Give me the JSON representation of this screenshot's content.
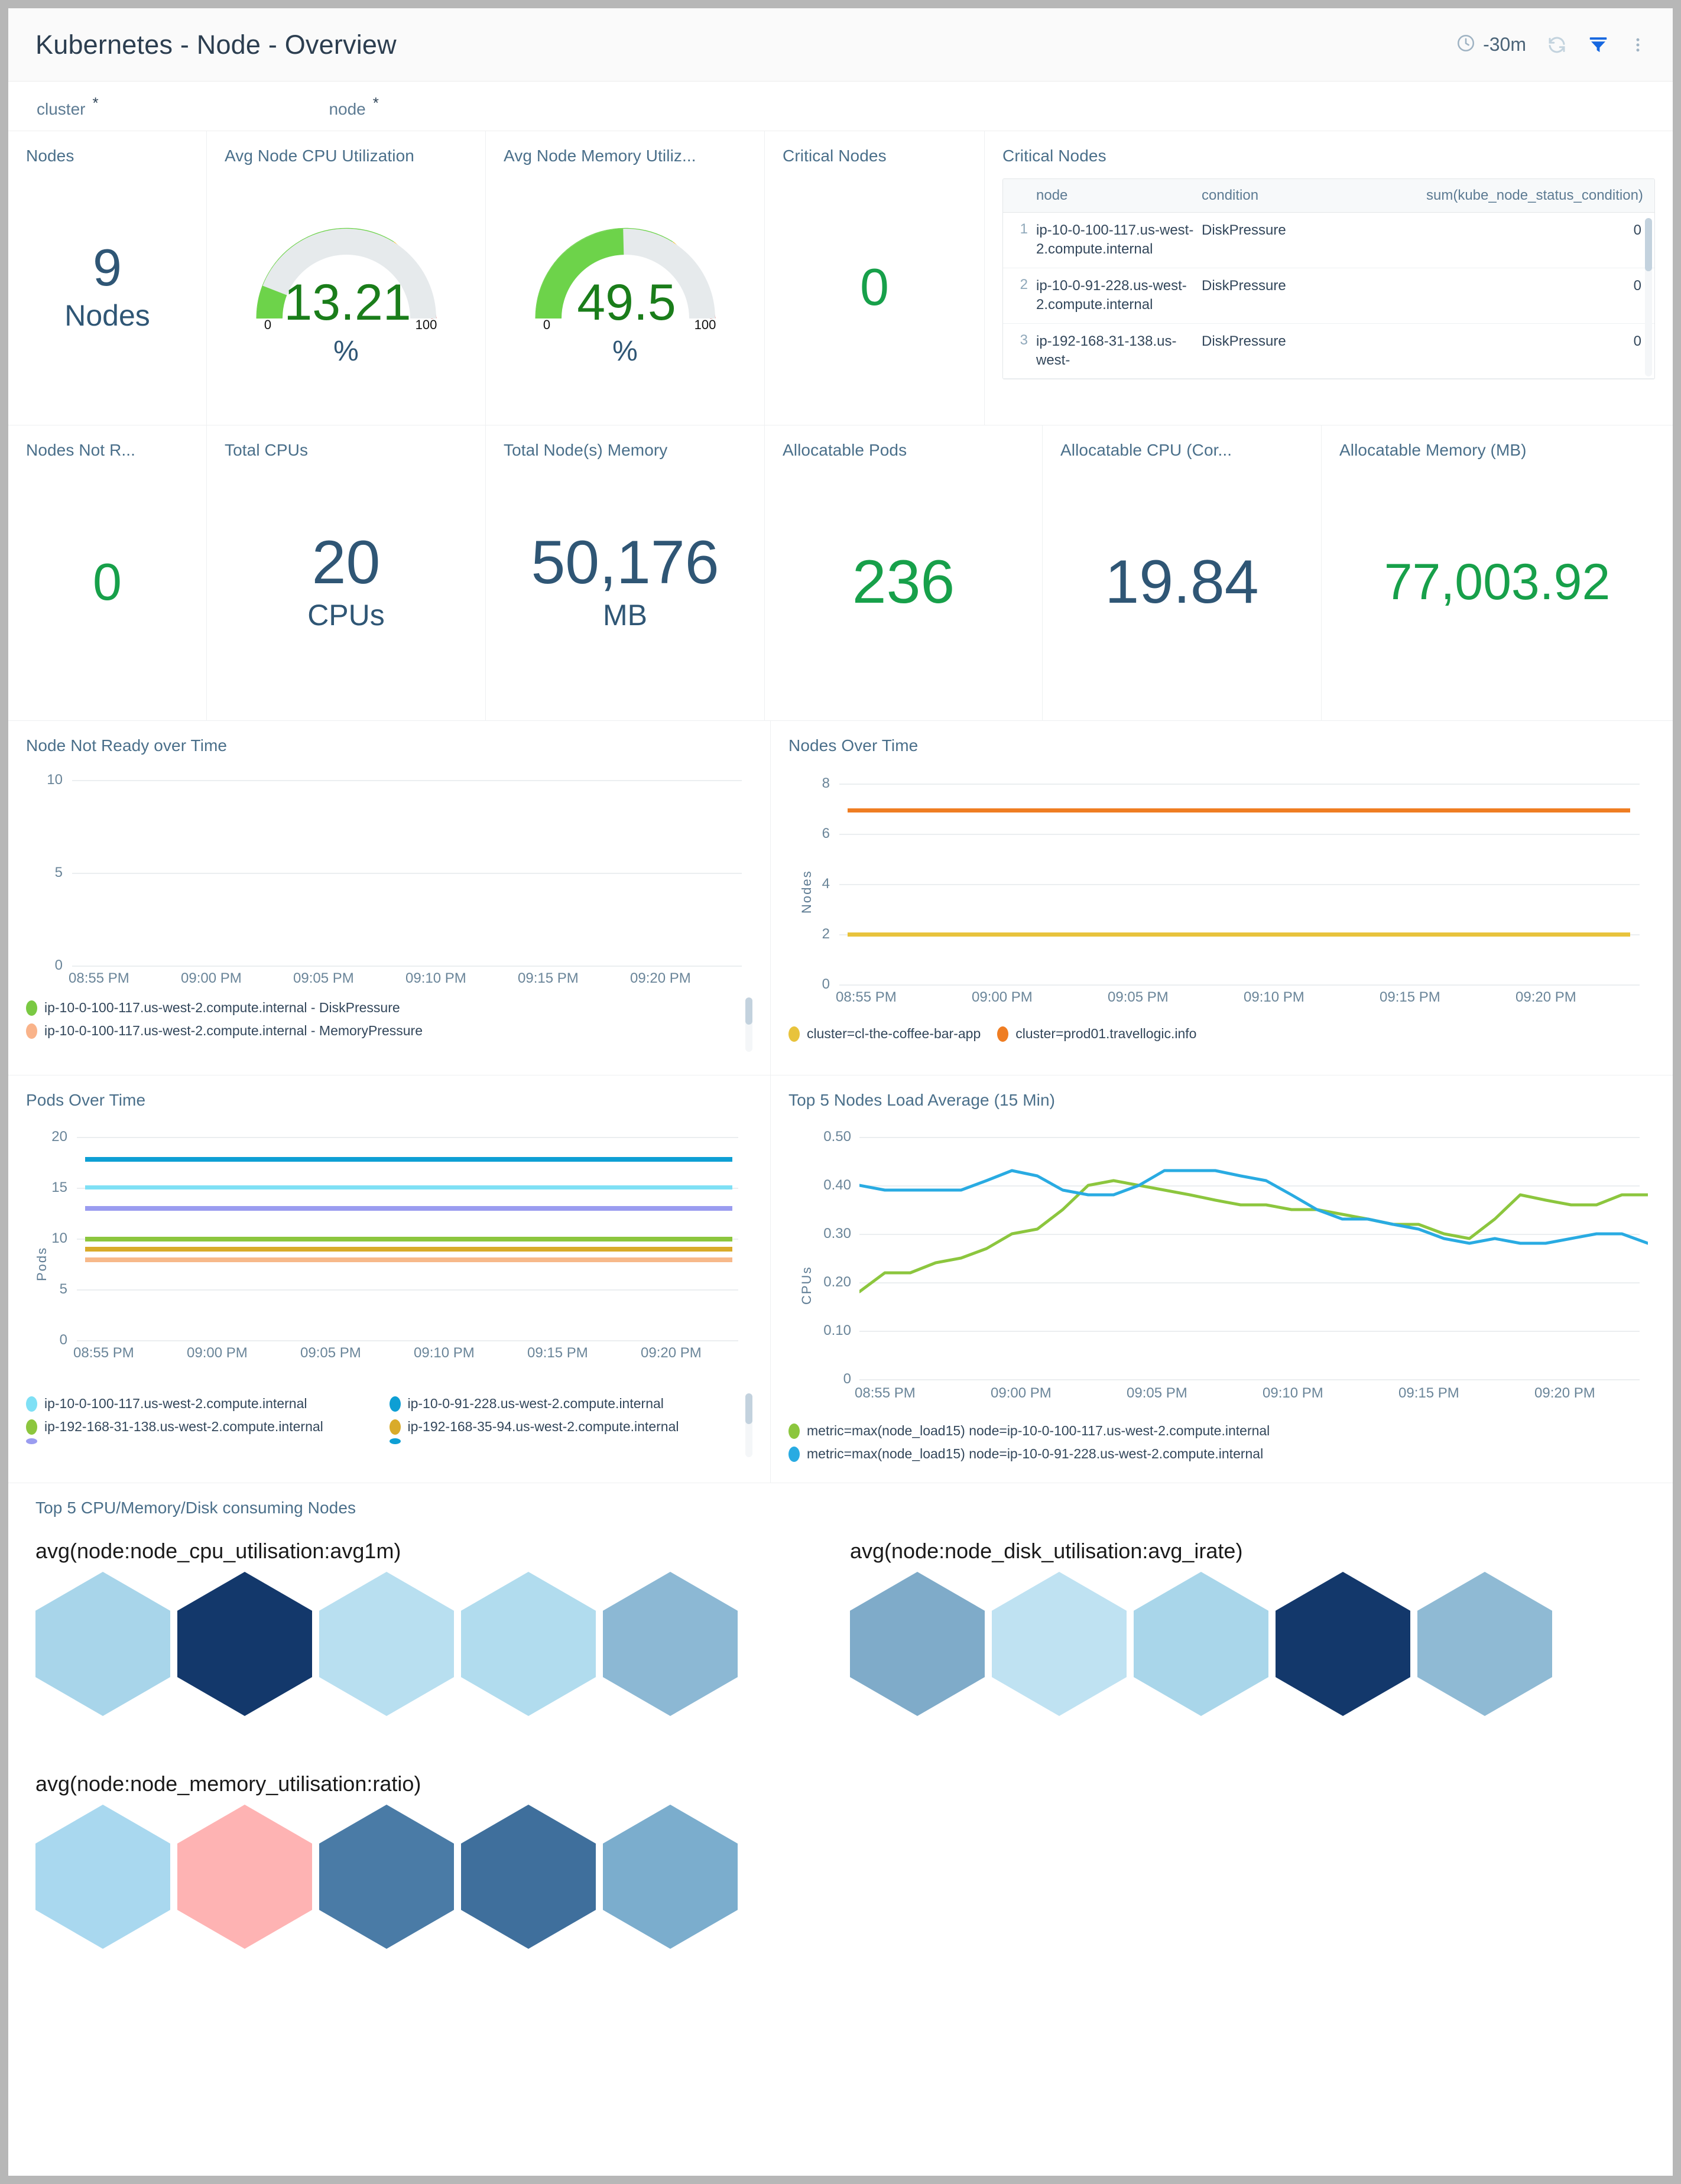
{
  "header": {
    "title": "Kubernetes - Node - Overview",
    "time_range": "-30m",
    "icons": [
      "clock-icon",
      "refresh-icon",
      "filter-icon",
      "more-options-icon"
    ]
  },
  "filters": [
    {
      "label": "cluster",
      "value": "*"
    },
    {
      "label": "node",
      "value": "*"
    }
  ],
  "panels": {
    "nodes": {
      "title": "Nodes",
      "value": "9",
      "unit": "Nodes",
      "color": "#2f5675"
    },
    "cpu_gauge": {
      "title": "Avg Node CPU Utilization",
      "value": "13.21",
      "unit": "%",
      "min": "0",
      "max": "100"
    },
    "mem_gauge": {
      "title": "Avg Node Memory Utiliz...",
      "value": "49.5",
      "unit": "%",
      "min": "0",
      "max": "100"
    },
    "critical_nodes_kpi": {
      "title": "Critical Nodes",
      "value": "0",
      "color": "#17a04a"
    },
    "critical_nodes_table": {
      "title": "Critical Nodes",
      "columns": [
        "node",
        "condition",
        "sum(kube_node_status_condition)"
      ],
      "rows": [
        {
          "idx": "1",
          "node": "ip-10-0-100-117.us-west-2.compute.internal",
          "condition": "DiskPressure",
          "sum": "0"
        },
        {
          "idx": "2",
          "node": "ip-10-0-91-228.us-west-2.compute.internal",
          "condition": "DiskPressure",
          "sum": "0"
        },
        {
          "idx": "3",
          "node": "ip-192-168-31-138.us-west-",
          "condition": "DiskPressure",
          "sum": "0"
        }
      ]
    },
    "nodes_not_ready": {
      "title": "Nodes Not R...",
      "value": "0",
      "color": "#17a04a"
    },
    "total_cpus": {
      "title": "Total CPUs",
      "value": "20",
      "unit": "CPUs",
      "color": "#2f5675"
    },
    "total_memory": {
      "title": "Total Node(s) Memory",
      "value": "50,176",
      "unit": "MB",
      "color": "#2f5675"
    },
    "allocatable_pods": {
      "title": "Allocatable Pods",
      "value": "236",
      "color": "#17a04a"
    },
    "allocatable_cpu": {
      "title": "Allocatable CPU (Cor...",
      "value": "19.84",
      "color": "#2f5675"
    },
    "allocatable_mem": {
      "title": "Allocatable Memory (MB)",
      "value": "77,003.92",
      "color": "#17a04a"
    }
  },
  "chart_data": [
    {
      "id": "node_not_ready_over_time",
      "type": "line",
      "title": "Node Not Ready over Time",
      "xlabel": "",
      "ylabel": "",
      "ylim": [
        0,
        10
      ],
      "yticks": [
        "0",
        "5",
        "10"
      ],
      "xticks": [
        "08:55 PM",
        "09:00 PM",
        "09:05 PM",
        "09:10 PM",
        "09:15 PM",
        "09:20 PM"
      ],
      "grid": true,
      "legend_position": "bottom",
      "series": [
        {
          "name": "ip-10-0-100-117.us-west-2.compute.internal - DiskPressure",
          "color": "#7ac943",
          "values": []
        },
        {
          "name": "ip-10-0-100-117.us-west-2.compute.internal - MemoryPressure",
          "color": "#f9b38a",
          "values": []
        }
      ]
    },
    {
      "id": "nodes_over_time",
      "type": "line",
      "title": "Nodes Over Time",
      "xlabel": "",
      "ylabel": "Nodes",
      "ylim": [
        0,
        8
      ],
      "yticks": [
        "0",
        "2",
        "4",
        "6",
        "8"
      ],
      "xticks": [
        "08:55 PM",
        "09:00 PM",
        "09:05 PM",
        "09:10 PM",
        "09:15 PM",
        "09:20 PM"
      ],
      "grid": true,
      "legend_position": "bottom",
      "series": [
        {
          "name": "cluster=cl-the-coffee-bar-app",
          "color": "#e8c33c",
          "constant": 2
        },
        {
          "name": "cluster=prod01.travellogic.info",
          "color": "#ef7d22",
          "constant": 7
        }
      ]
    },
    {
      "id": "pods_over_time",
      "type": "line",
      "title": "Pods Over Time",
      "xlabel": "",
      "ylabel": "Pods",
      "ylim": [
        0,
        20
      ],
      "yticks": [
        "0",
        "5",
        "10",
        "15",
        "20"
      ],
      "xticks": [
        "08:55 PM",
        "09:00 PM",
        "09:05 PM",
        "09:10 PM",
        "09:15 PM",
        "09:20 PM"
      ],
      "grid": true,
      "legend_position": "bottom",
      "series": [
        {
          "name": "ip-10-0-100-117.us-west-2.compute.internal",
          "color": "#7fe0f5",
          "constant": 15
        },
        {
          "name": "ip-10-0-91-228.us-west-2.compute.internal",
          "color": "#0e9fd4",
          "constant": 18
        },
        {
          "name": "ip-192-168-31-138.us-west-2.compute.internal",
          "color": "#8cc63e",
          "constant": 10
        },
        {
          "name": "ip-192-168-35-94.us-west-2.compute.internal",
          "color": "#d9ab2a",
          "constant": 9
        },
        {
          "name": "",
          "color": "#9a9cf0",
          "constant": 13
        },
        {
          "name": "",
          "color": "#f7b98a",
          "constant": 8
        }
      ]
    },
    {
      "id": "top5_load_average",
      "type": "line",
      "title": "Top 5 Nodes Load Average (15 Min)",
      "xlabel": "",
      "ylabel": "CPUs",
      "ylim": [
        0,
        0.5
      ],
      "yticks": [
        "0",
        "0.10",
        "0.20",
        "0.30",
        "0.40",
        "0.50"
      ],
      "xticks": [
        "08:55 PM",
        "09:00 PM",
        "09:05 PM",
        "09:10 PM",
        "09:15 PM",
        "09:20 PM"
      ],
      "grid": true,
      "legend_position": "bottom",
      "series": [
        {
          "name": "metric=max(node_load15) node=ip-10-0-100-117.us-west-2.compute.internal",
          "color": "#8cc63e",
          "values": [
            0.18,
            0.22,
            0.22,
            0.24,
            0.25,
            0.27,
            0.3,
            0.31,
            0.35,
            0.4,
            0.41,
            0.4,
            0.39,
            0.38,
            0.37,
            0.36,
            0.36,
            0.35,
            0.35,
            0.34,
            0.33,
            0.32,
            0.32,
            0.3,
            0.29,
            0.33,
            0.38,
            0.37,
            0.36,
            0.36,
            0.38
          ]
        },
        {
          "name": "metric=max(node_load15) node=ip-10-0-91-228.us-west-2.compute.internal",
          "color": "#29abe2",
          "values": [
            0.4,
            0.39,
            0.39,
            0.39,
            0.39,
            0.41,
            0.43,
            0.42,
            0.39,
            0.38,
            0.38,
            0.4,
            0.43,
            0.43,
            0.43,
            0.42,
            0.41,
            0.38,
            0.35,
            0.33,
            0.33,
            0.32,
            0.31,
            0.29,
            0.28,
            0.29,
            0.28,
            0.28,
            0.29,
            0.3,
            0.3,
            0.28
          ]
        }
      ]
    }
  ],
  "hex_section": {
    "title": "Top 5 CPU/Memory/Disk consuming Nodes",
    "groups": [
      {
        "id": "cpu",
        "title": "avg(node:node_cpu_utilisation:avg1m)",
        "colors": [
          "#a8d5ea",
          "#13386b",
          "#b8dff0",
          "#b1dcee",
          "#8cb8d4"
        ]
      },
      {
        "id": "disk",
        "title": "avg(node:node_disk_utilisation:avg_irate)",
        "colors": [
          "#7fabc9",
          "#bfe2f2",
          "#a9d6ea",
          "#13386b",
          "#8fbad4"
        ]
      },
      {
        "id": "memory",
        "title": "avg(node:node_memory_utilisation:ratio)",
        "colors": [
          "#a9d8ef",
          "#feb3b3",
          "#4a7ba6",
          "#3f6f9c",
          "#7badcd"
        ]
      }
    ]
  }
}
